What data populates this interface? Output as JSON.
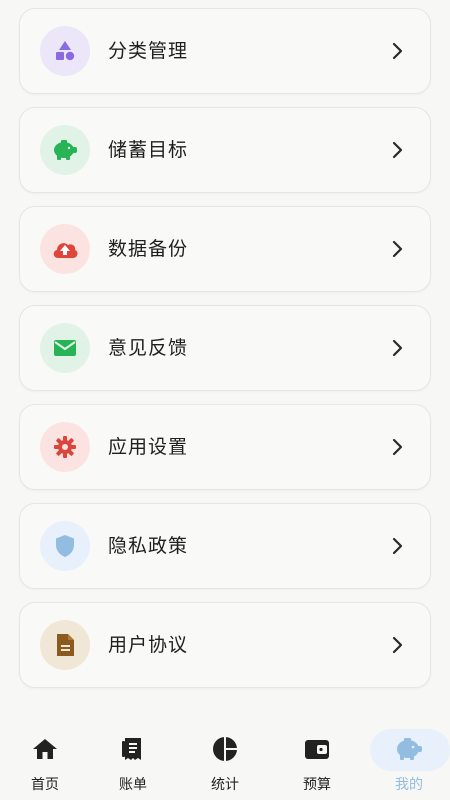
{
  "menu": {
    "items": [
      {
        "label": "分类管理",
        "icon": "shapes-icon",
        "icon_bg": "#ebe6f8",
        "icon_color": "#8b6be0"
      },
      {
        "label": "储蓄目标",
        "icon": "piggy-bank-icon",
        "icon_bg": "#e1f3e6",
        "icon_color": "#27b356"
      },
      {
        "label": "数据备份",
        "icon": "cloud-upload-icon",
        "icon_bg": "#fbe3e1",
        "icon_color": "#e0453c"
      },
      {
        "label": "意见反馈",
        "icon": "mail-icon",
        "icon_bg": "#e1f3e6",
        "icon_color": "#27b356"
      },
      {
        "label": "应用设置",
        "icon": "gear-icon",
        "icon_bg": "#fbe3e1",
        "icon_color": "#d9463e"
      },
      {
        "label": "隐私政策",
        "icon": "shield-icon",
        "icon_bg": "#e8f1fb",
        "icon_color": "#93bde0"
      },
      {
        "label": "用户协议",
        "icon": "document-icon",
        "icon_bg": "#f1e7d6",
        "icon_color": "#8a5a1f"
      }
    ]
  },
  "tabbar": {
    "tabs": [
      {
        "label": "首页",
        "icon": "home-icon"
      },
      {
        "label": "账单",
        "icon": "receipt-icon"
      },
      {
        "label": "统计",
        "icon": "pie-chart-icon"
      },
      {
        "label": "预算",
        "icon": "wallet-icon"
      },
      {
        "label": "我的",
        "icon": "piggy-bank-icon",
        "active": true
      }
    ],
    "active_color": "#93bde0"
  }
}
